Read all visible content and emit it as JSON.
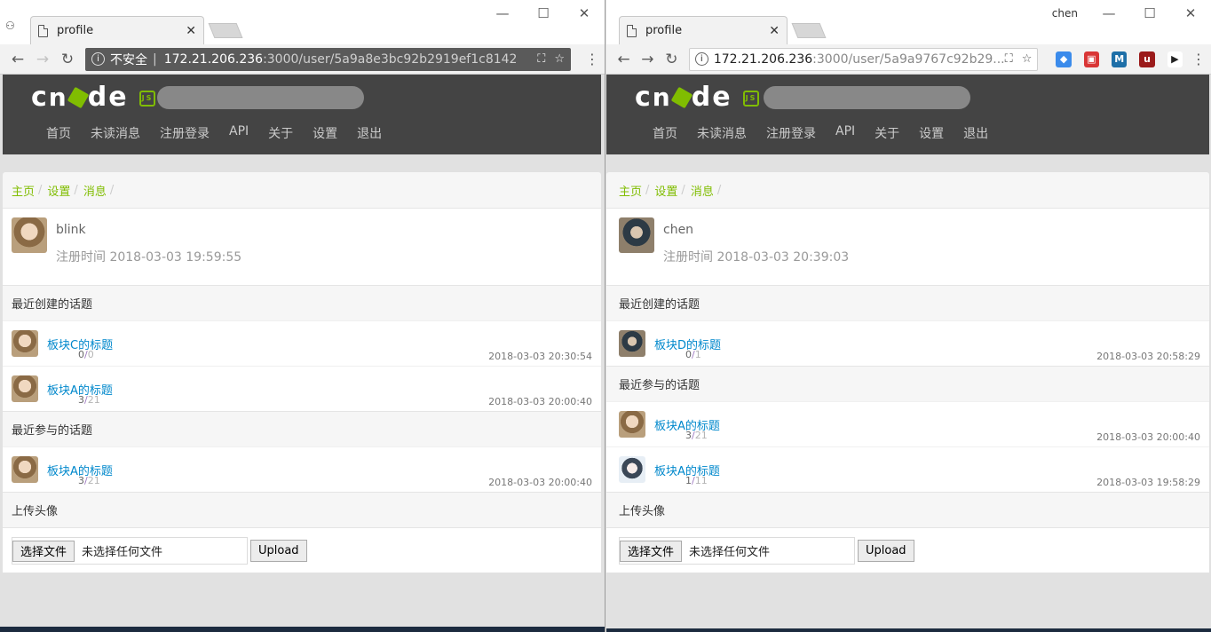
{
  "left": {
    "tab_title": "profile",
    "url_security": "不安全",
    "url_host": "172.21.206.236",
    "url_path": ":3000/user/5a9a8e3bc92b2919ef1c8142",
    "site_nav": [
      "首页",
      "未读消息",
      "注册登录",
      "API",
      "关于",
      "设置",
      "退出"
    ],
    "breadcrumb": [
      "主页",
      "设置",
      "消息"
    ],
    "user": {
      "name": "blink",
      "reg_label": "注册时间 2018-03-03 19:59:55"
    },
    "created_header": "最近创建的话题",
    "created": [
      {
        "title": "板块C的标题",
        "replies": "0",
        "visits": "0",
        "time": "2018-03-03 20:30:54"
      },
      {
        "title": "板块A的标题",
        "replies": "3",
        "visits": "21",
        "time": "2018-03-03 20:00:40"
      }
    ],
    "joined_header": "最近参与的话题",
    "joined": [
      {
        "title": "板块A的标题",
        "replies": "3",
        "visits": "21",
        "time": "2018-03-03 20:00:40"
      }
    ],
    "upload_header": "上传头像",
    "file_button": "选择文件",
    "file_none": "未选择任何文件",
    "upload_button": "Upload"
  },
  "right": {
    "profile_name": "chen",
    "tab_title": "profile",
    "url_host": "172.21.206.236",
    "url_path": ":3000/user/5a9a9767c92b29...",
    "site_nav": [
      "首页",
      "未读消息",
      "注册登录",
      "API",
      "关于",
      "设置",
      "退出"
    ],
    "breadcrumb": [
      "主页",
      "设置",
      "消息"
    ],
    "user": {
      "name": "chen",
      "reg_label": "注册时间 2018-03-03 20:39:03"
    },
    "created_header": "最近创建的话题",
    "created": [
      {
        "title": "板块D的标题",
        "replies": "0",
        "visits": "1",
        "time": "2018-03-03 20:58:29"
      }
    ],
    "joined_header": "最近参与的话题",
    "joined": [
      {
        "title": "板块A的标题",
        "replies": "3",
        "visits": "21",
        "time": "2018-03-03 20:00:40"
      },
      {
        "title": "板块A的标题",
        "replies": "1",
        "visits": "11",
        "time": "2018-03-03 19:58:29"
      }
    ],
    "upload_header": "上传头像",
    "file_button": "选择文件",
    "file_none": "未选择任何文件",
    "upload_button": "Upload"
  },
  "colors": {
    "accent": "#80bd01",
    "header_bg": "#444444",
    "link": "#0088cc"
  },
  "icons": [
    "incognito-icon",
    "document-icon",
    "close-icon",
    "back-icon",
    "forward-icon",
    "reload-icon",
    "info-icon",
    "translate-icon",
    "star-icon",
    "menu-icon",
    "minimize-icon",
    "maximize-icon",
    "window-close-icon"
  ]
}
